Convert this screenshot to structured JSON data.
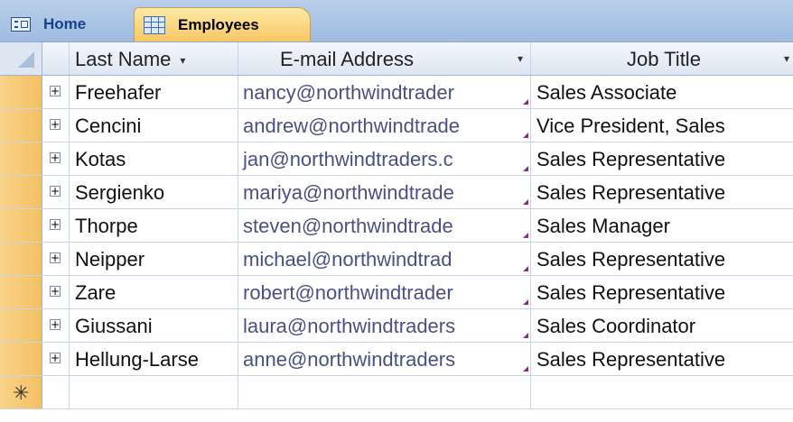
{
  "tabs": {
    "home_label": "Home",
    "employees_label": "Employees"
  },
  "columns": {
    "last_name": "Last Name",
    "email": "E-mail Address",
    "job_title": "Job Title"
  },
  "rows": [
    {
      "last": "Freehafer",
      "email": "nancy@northwindtrader",
      "job": "Sales Associate"
    },
    {
      "last": "Cencini",
      "email": "andrew@northwindtrade",
      "job": "Vice President, Sales"
    },
    {
      "last": "Kotas",
      "email": "jan@northwindtraders.c",
      "job": "Sales Representative"
    },
    {
      "last": "Sergienko",
      "email": "mariya@northwindtrade",
      "job": "Sales Representative"
    },
    {
      "last": "Thorpe",
      "email": "steven@northwindtrade",
      "job": "Sales Manager"
    },
    {
      "last": "Neipper",
      "email": "michael@northwindtrad",
      "job": "Sales Representative"
    },
    {
      "last": "Zare",
      "email": "robert@northwindtrader",
      "job": "Sales Representative"
    },
    {
      "last": "Giussani",
      "email": "laura@northwindtraders",
      "job": "Sales Coordinator"
    },
    {
      "last": "Hellung-Larse",
      "email": "anne@northwindtraders",
      "job": "Sales Representative"
    }
  ],
  "new_record_symbol": "✳",
  "expand_symbol": "+",
  "dropdown_symbol": "▾",
  "colors": {
    "selector": "#f4bf63",
    "active_tab": "#fde9a6",
    "header": "#dde6f1",
    "gridline": "#c5d6ec"
  }
}
